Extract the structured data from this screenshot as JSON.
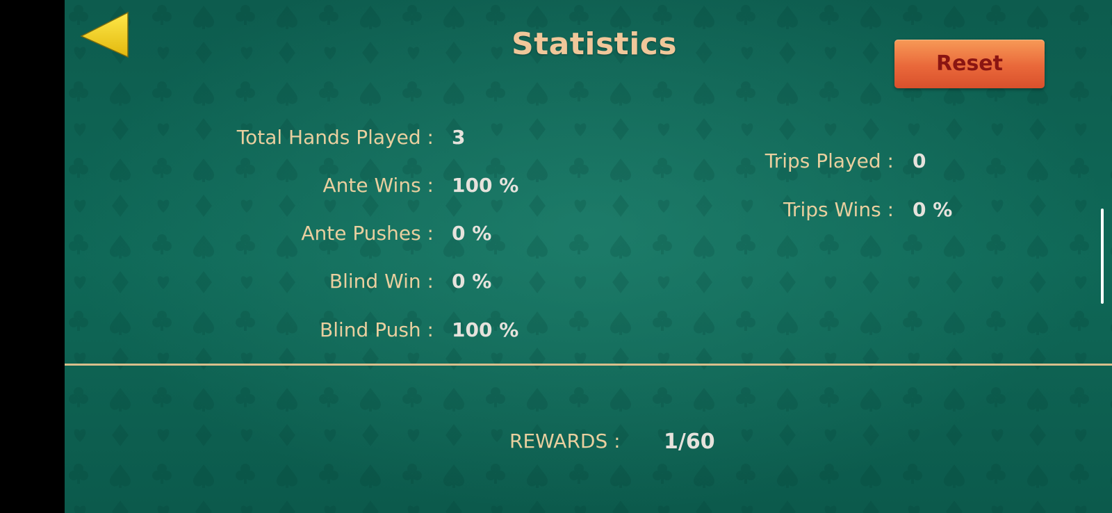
{
  "header": {
    "title": "Statistics",
    "back_icon": "back-arrow-icon",
    "reset_label": "Reset"
  },
  "stats_left": [
    {
      "label": "Total Hands Played :",
      "value": "3"
    },
    {
      "label": "Ante Wins :",
      "value": "100 %"
    },
    {
      "label": "Ante Pushes :",
      "value": "0 %"
    },
    {
      "label": "Blind Win :",
      "value": "0 %"
    },
    {
      "label": "Blind Push :",
      "value": "100 %"
    }
  ],
  "stats_right": [
    {
      "label": "Trips Played :",
      "value": "0"
    },
    {
      "label": "Trips Wins :",
      "value": "0 %"
    }
  ],
  "rewards": {
    "label": "REWARDS :",
    "value": "1/60"
  },
  "colors": {
    "felt": "#0f6857",
    "title": "#f0c79a",
    "label": "#e9cf9f",
    "value": "#e6e2dc",
    "reset_button": "#e9683a",
    "reset_text": "#8a1512",
    "back_arrow": "#f2d21b",
    "divider": "#d9bf8c"
  }
}
